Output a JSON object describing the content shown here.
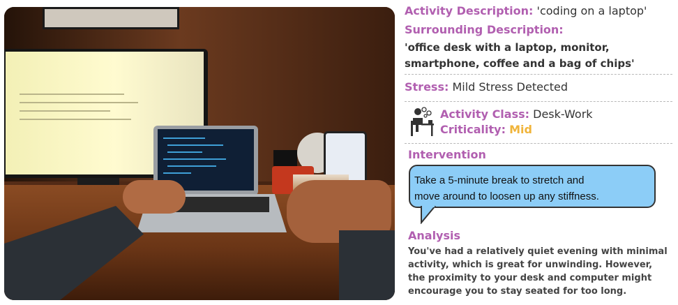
{
  "activity": {
    "label": "Activity Description:",
    "value": "'coding on a laptop'"
  },
  "surrounding": {
    "label": "Surrounding Description:",
    "line1": "'office desk with a laptop, monitor,",
    "line2": "smartphone, coffee and a bag of chips'"
  },
  "stress": {
    "label": "Stress:",
    "value": "Mild Stress Detected"
  },
  "activity_class": {
    "icon": "desk-worker-icon",
    "label": "Activity Class:",
    "value": "Desk-Work"
  },
  "criticality": {
    "label": "Criticality:",
    "value": "Mid",
    "color": "#f0b43a"
  },
  "intervention": {
    "label": "Intervention",
    "line1": "Take a 5-minute break to stretch and",
    "line2": "move around to loosen up any stiffness.",
    "bubble_color": "#8ccdf7"
  },
  "analysis": {
    "label": "Analysis",
    "line1": "You've had a relatively quiet evening with minimal",
    "line2": "activity, which is great for unwinding. However,",
    "line3": "the proximity to your desk and computer might",
    "line4": "encourage you to stay seated for too long."
  },
  "accent_color": "#b15fb0"
}
